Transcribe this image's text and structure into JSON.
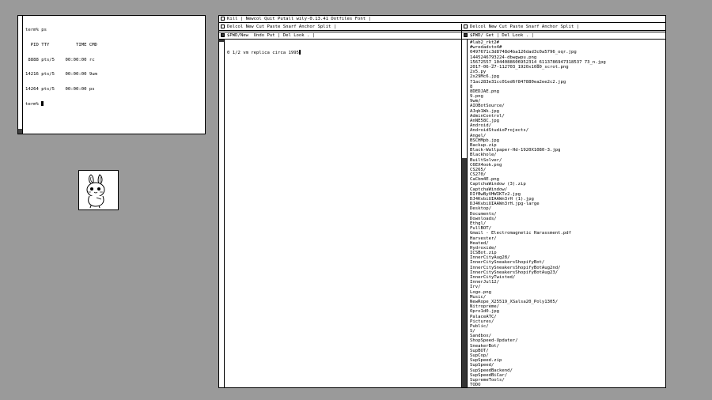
{
  "term": {
    "lines": [
      "term% ps",
      "  PID TTY          TIME CMD",
      " 8888 pts/5    00:00:00 rc",
      "14216 pts/5    00:00:00 9um",
      "14264 pts/5    00:00:00 ps",
      "term% "
    ]
  },
  "acme": {
    "main_tag": "Kill | Newcol Quit Putall wily-0.13.41 Dotfiles Font |",
    "left_col_tag": "Delcol New Cut Paste Snarf Anchor Split |",
    "left_win_tag": "$PWD/New  Undo Put | Del Look . |",
    "left_body": "0 1/2 vm replica circa 1995",
    "right_col_tag": "Delcol New Cut Paste Snarf Anchor Split |",
    "right_win_tag": "$PWD/ Get | Del Look . |",
    "files": [
      "#lab2_rkt2#",
      "#wredadsto4#",
      "0497671c3d8748d4ba126dad3c0a5796_oqr.jpg",
      "1445246793224-dbwgwpu.png",
      "15672557_1044088606952314_6113786947318537 73_n.jpg",
      "2017-06-27-112703_1920x1080_scrot.png",
      "2x5.py",
      "2x29Mc6.jpg",
      "71ac283e31cc01ed6f847880ea2ee2c2.jpg",
      "8",
      "8DEDJAE.png",
      "9.png",
      "9wm/",
      "AIOBotSource/",
      "AJqb1Wk.jpg",
      "AdminControl/",
      "AnNE58C.jpg",
      "Android/",
      "AndroidStudioProjects/",
      "Angel/",
      "BSCHMpb.jpg",
      "Backup.zip",
      "Black-Wallpaper-Hd-1920X1080-3.jpg",
      "Blackhole/",
      "BuiltSolver/",
      "C6EX4ook.png",
      "CS265/",
      "CS270/",
      "CaCbm4E.png",
      "CaptchaWindow (3).zip",
      "CaptchaWindow/",
      "DIfBwByVHWIKTz2.jpg",
      "DJ4KvbiUIAAWn3rH (1).jpg",
      "DJ4KvbiUIAAWn3rH.jpg-large",
      "Desktop/",
      "Documents/",
      "Downloads/",
      "Ethgl/",
      "FullBOT/",
      "Gmail - Electromagnetic Harassment.pdf",
      "Harvester/",
      "Heated/",
      "Hydroxide/",
      "ICSBot.zip",
      "InnerCityAug28/",
      "InnerCitySneakersShopifyBot/",
      "InnerCitySneakersShopifyBotAug2nd/",
      "InnerCitySneakersShopifyBotAug23/",
      "InnerCityTwisted/",
      "InnerJul12/",
      "Irv/",
      "Logo.png",
      "Music/",
      "NewRope_X25519_XSalsa20_Poly1305/",
      "Nitropreme/",
      "Opro1d0.jpg",
      "PalaceATC/",
      "Pictures/",
      "Public/",
      "S/",
      "Sandbox/",
      "ShopSpeed-Updater/",
      "SneakerBot/",
      "SupBOT/",
      "SupCop/",
      "SupSpeed.zip",
      "SupSpeed/",
      "SupSpeedBackend/",
      "SupSpeedBiCar/",
      "SupremeTools/",
      "TODO"
    ]
  }
}
